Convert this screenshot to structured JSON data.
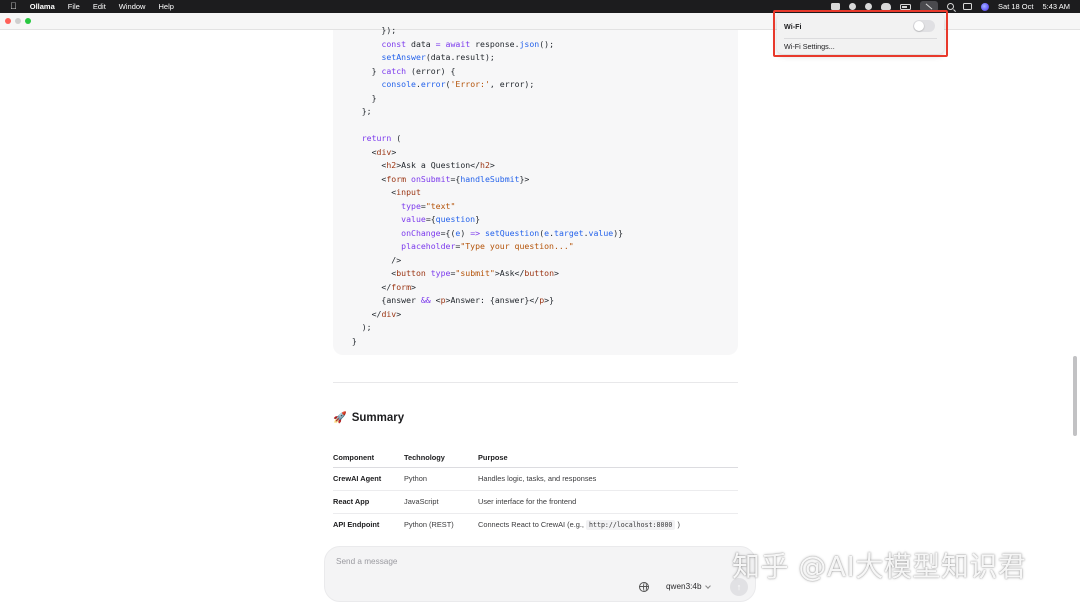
{
  "menubar": {
    "apple": "",
    "app_name": "Ollama",
    "menus": [
      "File",
      "Edit",
      "Window",
      "Help"
    ],
    "date": "Sat 18 Oct",
    "time": "5:43 AM"
  },
  "code": {
    "lines": [
      [
        [
          "t-plain",
          "        });"
        ]
      ],
      [
        [
          "t-plain",
          "        "
        ],
        [
          "t-kw",
          "const"
        ],
        [
          "t-plain",
          " data "
        ],
        [
          "t-kw",
          "="
        ],
        [
          "t-plain",
          " "
        ],
        [
          "t-kw",
          "await"
        ],
        [
          "t-plain",
          " response."
        ],
        [
          "t-fn",
          "json"
        ],
        [
          "t-plain",
          "();"
        ]
      ],
      [
        [
          "t-plain",
          "        "
        ],
        [
          "t-fn",
          "setAnswer"
        ],
        [
          "t-plain",
          "(data.result);"
        ]
      ],
      [
        [
          "t-plain",
          "      } "
        ],
        [
          "t-kw",
          "catch"
        ],
        [
          "t-plain",
          " (error) {"
        ]
      ],
      [
        [
          "t-plain",
          "        "
        ],
        [
          "t-var",
          "console"
        ],
        [
          "t-plain",
          "."
        ],
        [
          "t-fn",
          "error"
        ],
        [
          "t-plain",
          "("
        ],
        [
          "t-str",
          "'Error:'"
        ],
        [
          "t-plain",
          ", error);"
        ]
      ],
      [
        [
          "t-plain",
          "      }"
        ]
      ],
      [
        [
          "t-plain",
          "    };"
        ]
      ],
      [
        [
          "t-plain",
          ""
        ]
      ],
      [
        [
          "t-plain",
          "    "
        ],
        [
          "t-kw",
          "return"
        ],
        [
          "t-plain",
          " ("
        ]
      ],
      [
        [
          "t-plain",
          "      <"
        ],
        [
          "t-tag",
          "div"
        ],
        [
          "t-plain",
          ">"
        ]
      ],
      [
        [
          "t-plain",
          "        <"
        ],
        [
          "t-tag",
          "h2"
        ],
        [
          "t-plain",
          ">Ask a Question</"
        ],
        [
          "t-tag",
          "h2"
        ],
        [
          "t-plain",
          ">"
        ]
      ],
      [
        [
          "t-plain",
          "        <"
        ],
        [
          "t-tag",
          "form"
        ],
        [
          "t-plain",
          " "
        ],
        [
          "t-attr",
          "onSubmit"
        ],
        [
          "t-plain",
          "={"
        ],
        [
          "t-var",
          "handleSubmit"
        ],
        [
          "t-plain",
          "}>"
        ]
      ],
      [
        [
          "t-plain",
          "          <"
        ],
        [
          "t-tag",
          "input"
        ]
      ],
      [
        [
          "t-plain",
          "            "
        ],
        [
          "t-attr",
          "type"
        ],
        [
          "t-plain",
          "="
        ],
        [
          "t-str",
          "\"text\""
        ]
      ],
      [
        [
          "t-plain",
          "            "
        ],
        [
          "t-attr",
          "value"
        ],
        [
          "t-plain",
          "={"
        ],
        [
          "t-var",
          "question"
        ],
        [
          "t-plain",
          "}"
        ]
      ],
      [
        [
          "t-plain",
          "            "
        ],
        [
          "t-attr",
          "onChange"
        ],
        [
          "t-plain",
          "={("
        ],
        [
          "t-var",
          "e"
        ],
        [
          "t-plain",
          ") "
        ],
        [
          "t-kw",
          "=>"
        ],
        [
          "t-plain",
          " "
        ],
        [
          "t-fn",
          "setQuestion"
        ],
        [
          "t-plain",
          "("
        ],
        [
          "t-var",
          "e"
        ],
        [
          "t-plain",
          "."
        ],
        [
          "t-var",
          "target"
        ],
        [
          "t-plain",
          "."
        ],
        [
          "t-var",
          "value"
        ],
        [
          "t-plain",
          ")}"
        ]
      ],
      [
        [
          "t-plain",
          "            "
        ],
        [
          "t-attr",
          "placeholder"
        ],
        [
          "t-plain",
          "="
        ],
        [
          "t-str",
          "\"Type your question...\""
        ]
      ],
      [
        [
          "t-plain",
          "          />"
        ]
      ],
      [
        [
          "t-plain",
          "          <"
        ],
        [
          "t-tag",
          "button"
        ],
        [
          "t-plain",
          " "
        ],
        [
          "t-attr",
          "type"
        ],
        [
          "t-plain",
          "="
        ],
        [
          "t-str",
          "\"submit\""
        ],
        [
          "t-plain",
          ">Ask</"
        ],
        [
          "t-tag",
          "button"
        ],
        [
          "t-plain",
          ">"
        ]
      ],
      [
        [
          "t-plain",
          "        </"
        ],
        [
          "t-tag",
          "form"
        ],
        [
          "t-plain",
          ">"
        ]
      ],
      [
        [
          "t-plain",
          "        {answer "
        ],
        [
          "t-kw",
          "&&"
        ],
        [
          "t-plain",
          " <"
        ],
        [
          "t-tag",
          "p"
        ],
        [
          "t-plain",
          ">Answer: {answer}</"
        ],
        [
          "t-tag",
          "p"
        ],
        [
          "t-plain",
          ">}"
        ]
      ],
      [
        [
          "t-plain",
          "      </"
        ],
        [
          "t-tag",
          "div"
        ],
        [
          "t-plain",
          ">"
        ]
      ],
      [
        [
          "t-plain",
          "    );"
        ]
      ],
      [
        [
          "t-plain",
          "  }"
        ]
      ]
    ]
  },
  "summary": {
    "icon": "rocket-icon",
    "emoji": "🚀",
    "title": "Summary"
  },
  "table": {
    "headers": [
      "Component",
      "Technology",
      "Purpose"
    ],
    "rows": [
      {
        "component": "CrewAI Agent",
        "technology": "Python",
        "purpose": "Handles logic, tasks, and responses"
      },
      {
        "component": "React App",
        "technology": "JavaScript",
        "purpose": "User interface for the frontend"
      },
      {
        "component": "API Endpoint",
        "technology": "Python (REST)",
        "purpose_prefix": "Connects React to CrewAI (e.g., ",
        "purpose_code": "http://localhost:8000",
        "purpose_suffix": " )"
      }
    ]
  },
  "composer": {
    "placeholder": "Send a message",
    "model": "qwen3:4b"
  },
  "wifi_menu": {
    "title": "Wi-Fi",
    "enabled": false,
    "settings_label": "Wi-Fi Settings..."
  },
  "watermark": "知乎 @AI大模型知识君",
  "colors": {
    "highlight": "#e8392b",
    "traffic_red": "#ff5f57",
    "traffic_green": "#28c840"
  }
}
